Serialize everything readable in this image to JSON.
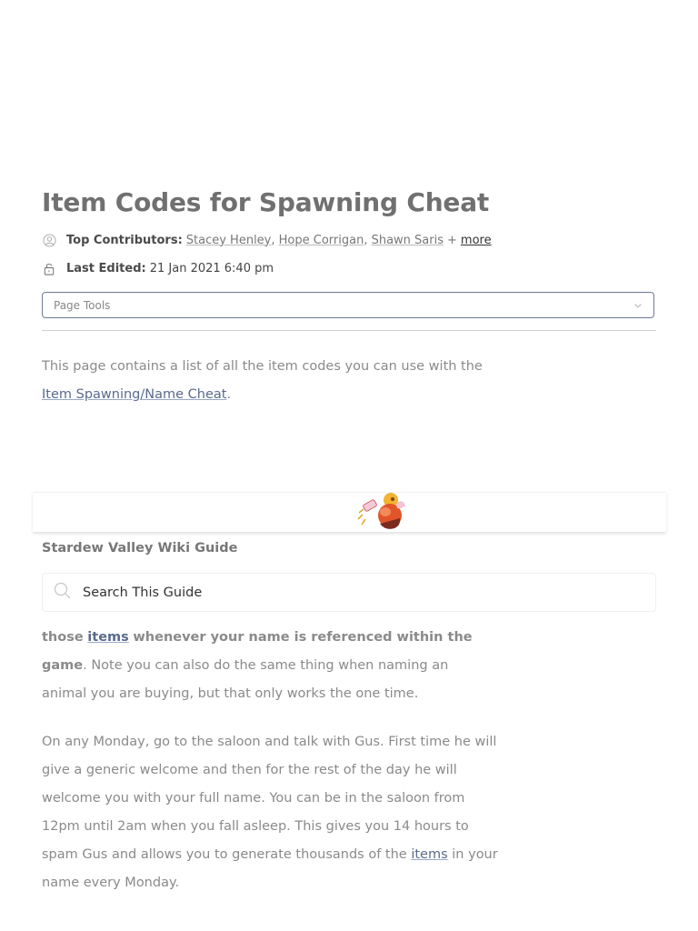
{
  "article": {
    "title": "Item Codes for Spawning Cheat",
    "contributors_label": "Top Contributors:",
    "contributors": [
      "Stacey Henley",
      "Hope Corrigan",
      "Shawn Saris"
    ],
    "plus": "+",
    "more_label": "more",
    "last_edited_label": "Last Edited:",
    "last_edited_value": "21 Jan 2021 6:40 pm",
    "page_tools_label": "Page Tools",
    "intro_text": "This page contains a list of all the item codes you can use with the",
    "intro_link": "Item Spawning/Name Cheat",
    "intro_end": "."
  },
  "guide": {
    "title": "Stardew Valley Wiki Guide",
    "search_placeholder": "Search This Guide"
  },
  "body": {
    "p1_bold_a": "those",
    "p1_link": "items",
    "p1_bold_b": "whenever your name is referenced within the game",
    "p1_rest": ". Note you can also do the same thing when naming an animal you are buying, but that only works the one time.",
    "p2_text": "On any Monday, go to the saloon and talk with Gus. First time he will give a generic welcome and then for the rest of the day he will welcome you with your full name. You can be in the saloon from 12pm until 2am when you fall asleep. This gives you 14 hours to spam Gus and allows you to generate thousands of the",
    "p2_link": "items",
    "p2_end": "in your name every Monday."
  },
  "icons": {
    "contributors": "user-circle-icon",
    "last_edited": "lock-icon",
    "page_tools": "chevron-down-icon",
    "search": "search-icon",
    "mascot": "guide-mascot-image"
  },
  "colors": {
    "title": "#707070",
    "link": "#5a6b8c",
    "body_text": "#8a8a8a",
    "page_tools_border": "#6c7a96"
  }
}
